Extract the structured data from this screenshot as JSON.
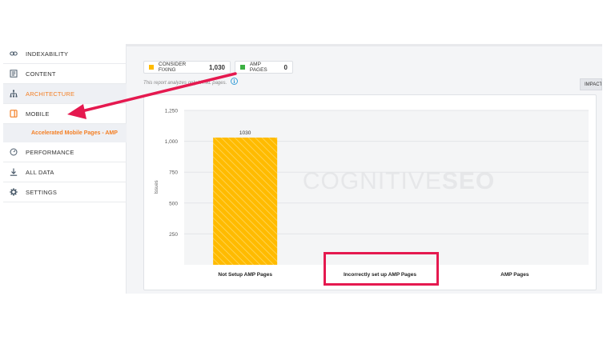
{
  "sidebar": {
    "items": [
      {
        "label": "INDEXABILITY",
        "icon": "link-icon"
      },
      {
        "label": "CONTENT",
        "icon": "document-icon"
      },
      {
        "label": "ARCHITECTURE",
        "icon": "sitemap-icon"
      },
      {
        "label": "MOBILE",
        "icon": "mobile-icon"
      },
      {
        "label": "PERFORMANCE",
        "icon": "gauge-icon"
      },
      {
        "label": "ALL DATA",
        "icon": "download-icon"
      },
      {
        "label": "SETTINGS",
        "icon": "gear-icon"
      }
    ],
    "sub_item": "Accelerated Mobile Pages - AMP"
  },
  "badges": {
    "consider_fixing_label": "CONSIDER FIXING",
    "consider_fixing_count": "1,030",
    "amp_pages_label": "AMP PAGES",
    "amp_pages_count": "0"
  },
  "note": "This report analyzes only HTML pages.",
  "impact_label": "IMPACT",
  "watermark": {
    "light": "COGNITIVE",
    "bold": "SEO"
  },
  "colors": {
    "accent": "#f47f24",
    "bar": "#ffbb00",
    "amp_green": "#3cb043",
    "annotation": "#e5194f"
  },
  "chart_data": {
    "type": "bar",
    "categories": [
      "Not Setup AMP Pages",
      "Incorrectly set up AMP Pages",
      "AMP Pages"
    ],
    "values": [
      1030,
      0,
      0
    ],
    "data_labels": [
      "1030",
      "",
      ""
    ],
    "ylabel": "Issues",
    "ylim": [
      0,
      1250
    ],
    "yticks": [
      250,
      500,
      750,
      "1,000",
      "1,250"
    ],
    "grid": true
  }
}
